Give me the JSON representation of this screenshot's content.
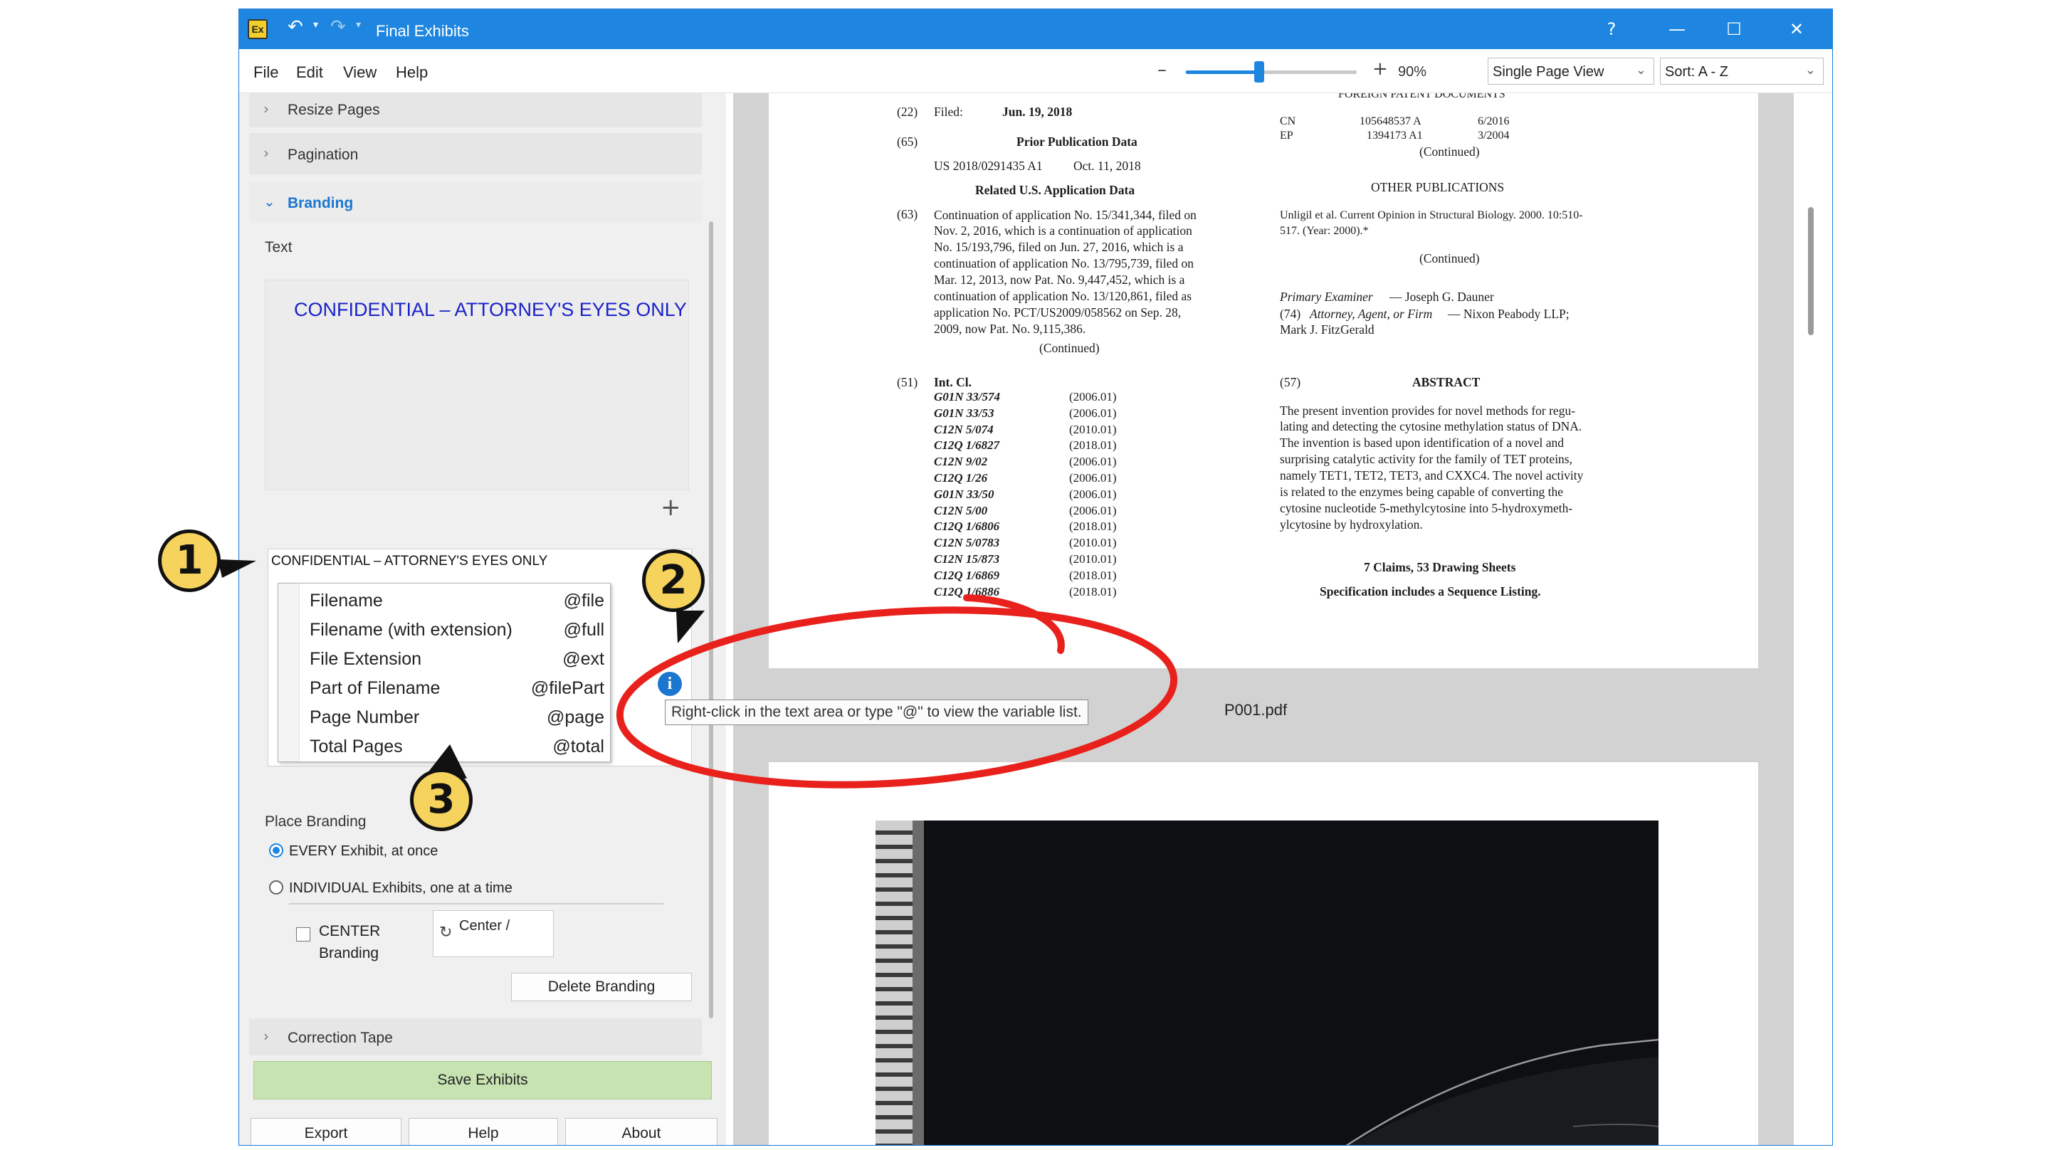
{
  "app": {
    "icon_label": "Ex",
    "title": "Final Exhibits",
    "help_glyph": "?",
    "accent_color": "#1e86e0"
  },
  "menu": {
    "file": "File",
    "edit": "Edit",
    "view": "View",
    "help": "Help"
  },
  "toolbar": {
    "zoom_minus": "–",
    "zoom_plus": "+",
    "zoom_level": "90%",
    "zoom_fraction": 0.43,
    "view_mode": "Single Page View",
    "sort": "Sort: A - Z"
  },
  "panel": {
    "sections": {
      "resize_pages": "Resize Pages",
      "pagination": "Pagination",
      "branding": "Branding",
      "correction_tape": "Correction Tape"
    },
    "branding": {
      "text_label": "Text",
      "preview_text": "CONFIDENTIAL – ATTORNEY'S EYES ONLY",
      "preview_color": "#1a22c8",
      "input_value": "CONFIDENTIAL – ATTORNEY'S EYES ONLY",
      "variables": [
        {
          "name": "Filename",
          "token": "@file"
        },
        {
          "name": "Filename (with extension)",
          "token": "@full"
        },
        {
          "name": "File Extension",
          "token": "@ext"
        },
        {
          "name": "Part of Filename",
          "token": "@filePart"
        },
        {
          "name": "Page Number",
          "token": "@page"
        },
        {
          "name": "Total Pages",
          "token": "@total"
        }
      ],
      "place_label": "Place Branding",
      "option_every": "EVERY Exhibit, at once",
      "option_individual": "INDIVIDUAL Exhibits, one at a time",
      "selected_option": "EVERY Exhibit, at once",
      "center_label_1": "CENTER",
      "center_label_2": "Branding",
      "center_checked": false,
      "position_value": "Center /",
      "delete_button": "Delete Branding"
    },
    "save_button": "Save Exhibits",
    "save_color": "#c7e3b2",
    "export_button": "Export",
    "help_button": "Help",
    "about_button": "About"
  },
  "tooltip": {
    "text": "Right-click in the text area or type \"@\" to view the variable list."
  },
  "annotations": {
    "badge_1": "1",
    "badge_2": "2",
    "badge_3": "3",
    "badge_color": "#f6d35d",
    "highlight_color": "#e8211c"
  },
  "document": {
    "page_caption": "P001.pdf",
    "left": {
      "filed_num": "(22)",
      "filed_label": "Filed:",
      "filed_date": "Jun. 19, 2018",
      "prior_num": "(65)",
      "prior_heading": "Prior Publication Data",
      "prior_pub": "US 2018/0291435 A1",
      "prior_date": "Oct. 11, 2018",
      "related_heading": "Related U.S. Application Data",
      "related_num": "(63)",
      "related_lines": [
        "Continuation of application No. 15/341,344, filed on",
        "Nov. 2, 2016, which is a continuation of application",
        "No. 15/193,796, filed on Jun. 27, 2016, which is a",
        "continuation of application No. 13/795,739, filed on",
        "Mar. 12, 2013, now Pat. No. 9,447,452, which is a",
        "continuation of application No. 13/120,861, filed as",
        "application No. PCT/US2009/058562 on Sep. 28,",
        "2009, now Pat. No. 9,115,386."
      ],
      "continued": "(Continued)",
      "intcl_num": "(51)",
      "intcl_heading": "Int. Cl.",
      "classes": [
        {
          "code": "G01N 33/574",
          "year": "(2006.01)"
        },
        {
          "code": "G01N 33/53",
          "year": "(2006.01)"
        },
        {
          "code": "C12N 5/074",
          "year": "(2010.01)"
        },
        {
          "code": "C12Q 1/6827",
          "year": "(2018.01)"
        },
        {
          "code": "C12N 9/02",
          "year": "(2006.01)"
        },
        {
          "code": "C12Q 1/26",
          "year": "(2006.01)"
        },
        {
          "code": "G01N 33/50",
          "year": "(2006.01)"
        },
        {
          "code": "C12N 5/00",
          "year": "(2006.01)"
        },
        {
          "code": "C12Q 1/6806",
          "year": "(2018.01)"
        },
        {
          "code": "C12N 5/0783",
          "year": "(2010.01)"
        },
        {
          "code": "C12N 15/873",
          "year": "(2010.01)"
        },
        {
          "code": "C12Q 1/6869",
          "year": "(2018.01)"
        },
        {
          "code": "C12Q 1/6886",
          "year": "(2018.01)"
        }
      ]
    },
    "right": {
      "foreign_heading": "FOREIGN PATENT DOCUMENTS",
      "foreign_rows": [
        {
          "cc": "CN",
          "num": "105648537 A",
          "date": "6/2016"
        },
        {
          "cc": "EP",
          "num": "1394173 A1",
          "date": "3/2004"
        }
      ],
      "continued": "(Continued)",
      "other_heading": "OTHER PUBLICATIONS",
      "other_line_1": "Unligil et al. Current Opinion in Structural Biology. 2000. 10:510-",
      "other_line_2": "517. (Year: 2000).*",
      "examiner_label": "Primary Examiner",
      "examiner_name": "— Joseph G. Dauner",
      "attorney_num": "(74)",
      "attorney_label": "Attorney, Agent, or Firm",
      "attorney_name": "— Nixon Peabody LLP;",
      "attorney_line_2": "Mark J. FitzGerald",
      "abstract_num": "(57)",
      "abstract_heading": "ABSTRACT",
      "abstract_lines": [
        "The present invention provides for novel methods for regu-",
        "lating and detecting the cytosine methylation status of DNA.",
        "The invention is based upon identification of a novel and",
        "surprising catalytic activity for the family of TET proteins,",
        "namely TET1, TET2, TET3, and CXXC4. The novel activity",
        "is related to the enzymes being capable of converting the",
        "cytosine nucleotide 5-methylcytosine into 5-hydroxymeth-",
        "ylcytosine by hydroxylation."
      ],
      "claims": "7 Claims, 53 Drawing Sheets",
      "sequence": "Specification includes a Sequence Listing."
    }
  }
}
